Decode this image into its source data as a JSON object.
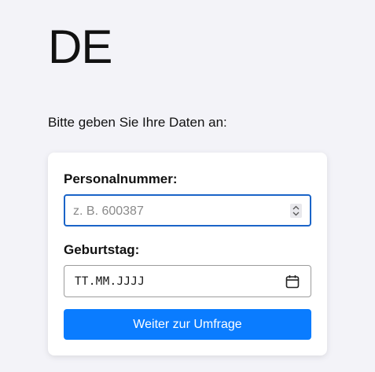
{
  "header": {
    "language_code": "DE"
  },
  "intro": {
    "text": "Bitte geben Sie Ihre Daten an:"
  },
  "form": {
    "personalnummer": {
      "label": "Personalnummer:",
      "placeholder": "z. B. 600387",
      "value": ""
    },
    "geburtstag": {
      "label": "Geburtstag:",
      "format_text": "TT.MM.JJJJ",
      "icon": "calendar-icon"
    },
    "submit_label": "Weiter zur Umfrage"
  },
  "colors": {
    "accent": "#0a7cff",
    "focus_border": "#1a64c8",
    "background": "#f3f3f8"
  }
}
